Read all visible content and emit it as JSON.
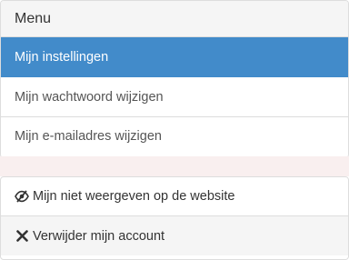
{
  "menu": {
    "heading": "Menu",
    "items": [
      {
        "label": "Mijn instellingen",
        "active": true
      },
      {
        "label": "Mijn wachtwoord wijzigen",
        "active": false
      },
      {
        "label": "Mijn e-mailadres wijzigen",
        "active": false
      }
    ]
  },
  "account": {
    "hide_label": "Mijn niet weergeven op de website",
    "hide_icon": "eye-slash-icon",
    "delete_label": "Verwijder mijn account",
    "delete_icon": "close-icon"
  },
  "colors": {
    "active_bg": "#428bca",
    "border": "#dddddd",
    "heading_bg": "#f5f5f5",
    "strip_bg": "#f9efef"
  }
}
